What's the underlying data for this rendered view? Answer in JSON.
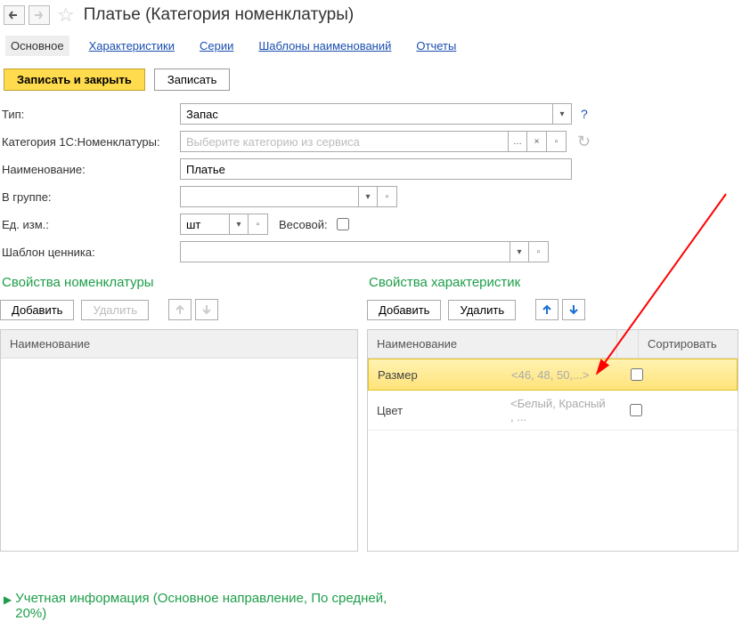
{
  "header": {
    "title": "Платье (Категория номенклатуры)"
  },
  "tabs": [
    {
      "label": "Основное",
      "active": true
    },
    {
      "label": "Характеристики"
    },
    {
      "label": "Серии"
    },
    {
      "label": "Шаблоны наименований"
    },
    {
      "label": "Отчеты"
    }
  ],
  "toolbar": {
    "save_close": "Записать и закрыть",
    "save": "Записать"
  },
  "fields": {
    "type_label": "Тип:",
    "type_value": "Запас",
    "cat1c_label": "Категория 1С:Номенклатуры:",
    "cat1c_placeholder": "Выберите категорию из сервиса",
    "name_label": "Наименование:",
    "name_value": "Платье",
    "group_label": "В группе:",
    "uom_label": "Ед. изм.:",
    "uom_value": "шт",
    "weight_label": "Весовой:",
    "price_tpl_label": "Шаблон ценника:"
  },
  "panels": {
    "item_props": {
      "title": "Свойства номенклатуры",
      "add": "Добавить",
      "delete": "Удалить",
      "col_name": "Наименование"
    },
    "char_props": {
      "title": "Свойства характеристик",
      "add": "Добавить",
      "delete": "Удалить",
      "col_name": "Наименование",
      "col_sort": "Сортировать",
      "rows": [
        {
          "name": "Размер",
          "hint": "<46, 48, 50,...>",
          "selected": true
        },
        {
          "name": "Цвет",
          "hint": "<Белый, Красный , ...",
          "selected": false
        }
      ]
    }
  },
  "footer": {
    "accounting_info": "Учетная информация (Основное направление, По средней, 20%)"
  }
}
